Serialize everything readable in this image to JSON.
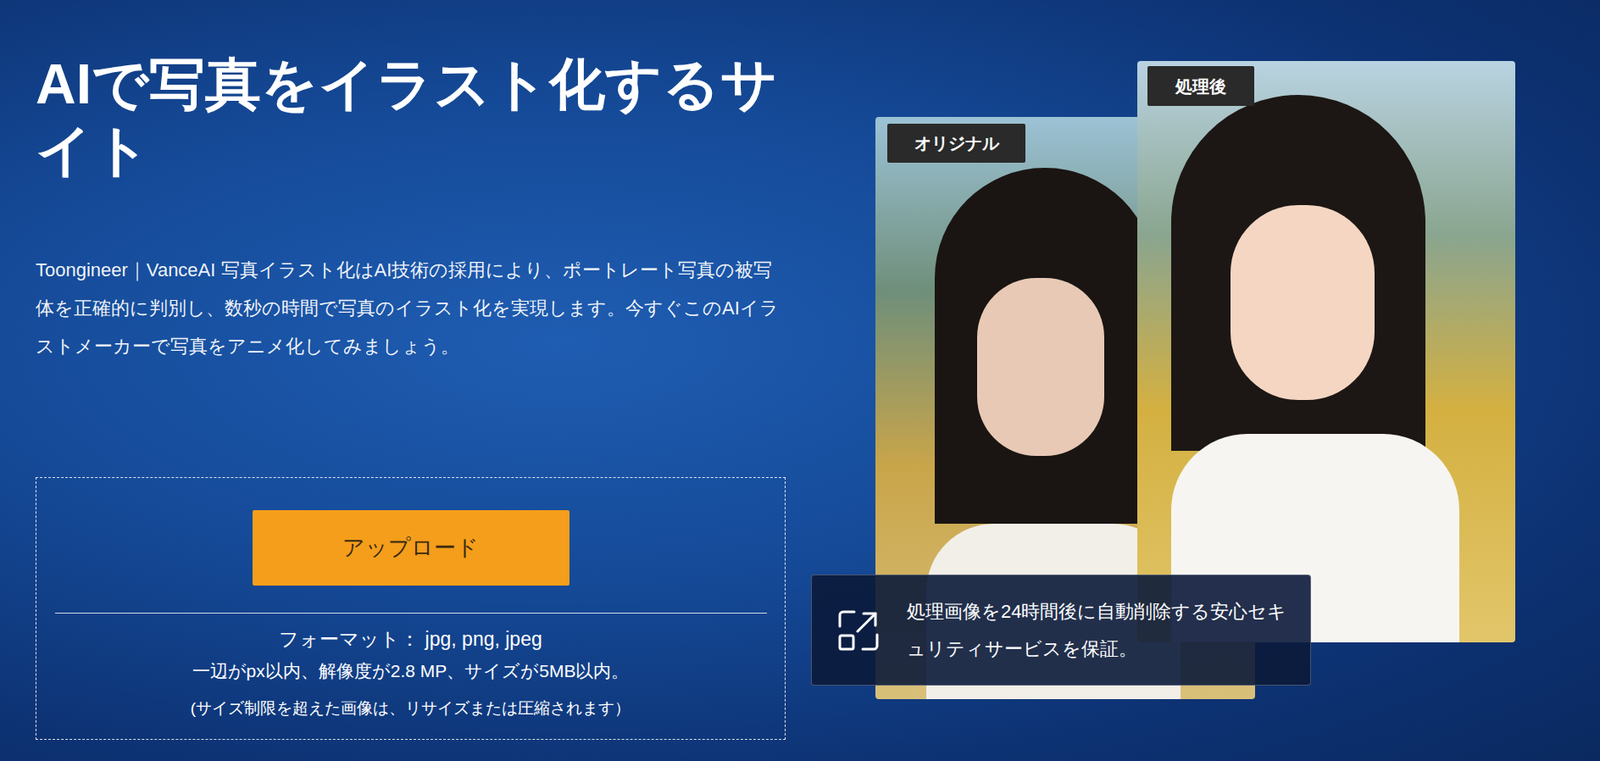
{
  "title": "AIで写真をイラスト化するサイト",
  "description": "Toongineer｜VanceAI 写真イラスト化はAI技術の採用により、ポートレート写真の被写体を正確的に判別し、数秒の時間で写真のイラスト化を実現します。今すぐこのAIイラストメーカーで写真をアニメ化してみましょう。",
  "upload": {
    "button": "アップロード",
    "format": "フォーマット： jpg, png, jpeg",
    "limits": "一辺がpx以内、解像度が2.8 MP、サイズが5MB以内。",
    "note": "(サイズ制限を超えた画像は、リサイズまたは圧縮されます）"
  },
  "preview": {
    "original_label": "オリジナル",
    "processed_label": "処理後"
  },
  "security_notice": "処理画像を24時間後に自動削除する安心セキュリティサービスを保証。"
}
